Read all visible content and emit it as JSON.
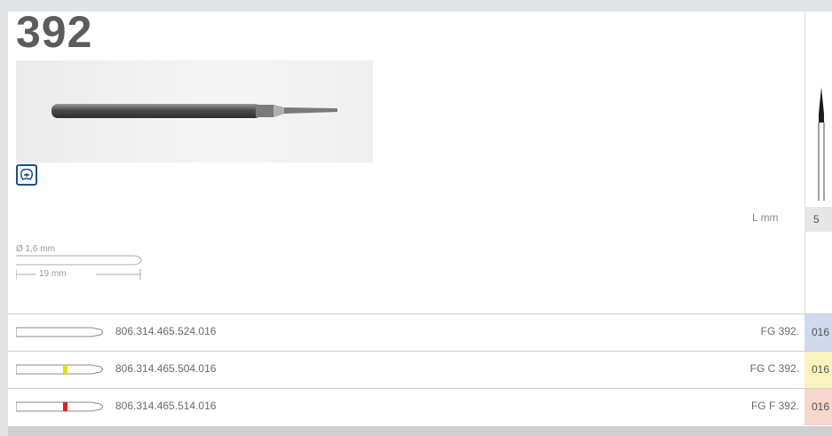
{
  "product": {
    "title": "392"
  },
  "badge": {
    "icon": "tooth-icon"
  },
  "spec": {
    "length_label": "L mm",
    "length_value": "5"
  },
  "dimensions": {
    "diameter": "Ø 1,6 mm",
    "length": "19 mm"
  },
  "rows": [
    {
      "number": "806.314.465.524.016",
      "code": "FG 392.",
      "size": "016",
      "color": "#cfdaee",
      "band": ""
    },
    {
      "number": "806.314.465.504.016",
      "code": "FG C 392.",
      "size": "016",
      "color": "#fbf3bd",
      "band": "#e5e000"
    },
    {
      "number": "806.314.465.514.016",
      "code": "FG F 392.",
      "size": "016",
      "color": "#f7d6cc",
      "band": "#e02020"
    }
  ]
}
